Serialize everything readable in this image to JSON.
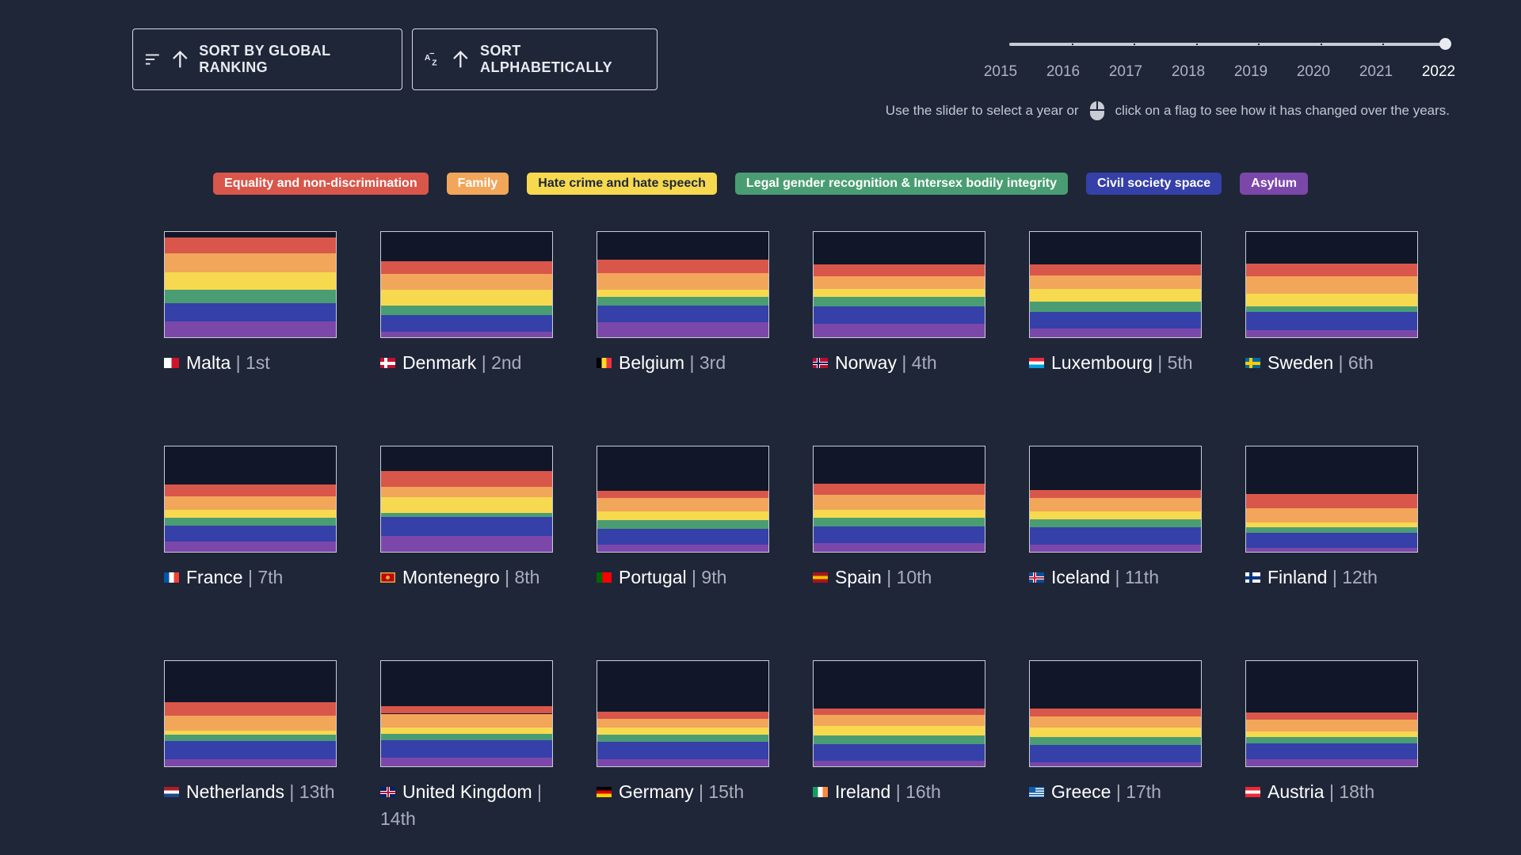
{
  "sort_buttons": {
    "global_label": "SORT BY GLOBAL RANKING",
    "alpha_label": "SORT ALPHABETICALLY"
  },
  "year_slider": {
    "years": [
      "2015",
      "2016",
      "2017",
      "2018",
      "2019",
      "2020",
      "2021",
      "2022"
    ],
    "selected": "2022"
  },
  "hint": {
    "before": "Use the slider to select a year or",
    "after": "click on a flag to see how it has changed over the years."
  },
  "legend": [
    {
      "label": "Equality and non-discrimination",
      "color": "#d9564a"
    },
    {
      "label": "Family",
      "color": "#f2a65a"
    },
    {
      "label": "Hate crime and hate speech",
      "color": "#f6d94f",
      "text_color": "#1f2638"
    },
    {
      "label": "Legal gender recognition & Intersex bodily integrity",
      "color": "#4a9d73"
    },
    {
      "label": "Civil society space",
      "color": "#3540a8"
    },
    {
      "label": "Asylum",
      "color": "#7b48aa"
    }
  ],
  "countries": [
    {
      "name": "Malta",
      "rank": "1st",
      "flag_icon": "malta-flag-icon",
      "mini": [
        "#ffffff",
        "#cf142b"
      ],
      "mini_dir": "v",
      "scores": [
        0.15,
        0.18,
        0.17,
        0.13,
        0.17,
        0.15
      ]
    },
    {
      "name": "Denmark",
      "rank": "2nd",
      "flag_icon": "denmark-flag-icon",
      "mini": [
        "#c8102e",
        "#ffffff"
      ],
      "mini_dir": "cross",
      "scores": [
        0.12,
        0.15,
        0.15,
        0.09,
        0.16,
        0.05
      ]
    },
    {
      "name": "Belgium",
      "rank": "3rd",
      "flag_icon": "belgium-flag-icon",
      "mini": [
        "#000000",
        "#fdda24",
        "#ef3340"
      ],
      "mini_dir": "v",
      "scores": [
        0.13,
        0.16,
        0.07,
        0.08,
        0.16,
        0.14
      ]
    },
    {
      "name": "Norway",
      "rank": "4th",
      "flag_icon": "norway-flag-icon",
      "mini": [
        "#ba0c2f",
        "#ffffff",
        "#00205b"
      ],
      "mini_dir": "cross",
      "scores": [
        0.11,
        0.12,
        0.08,
        0.09,
        0.16,
        0.13
      ]
    },
    {
      "name": "Luxembourg",
      "rank": "5th",
      "flag_icon": "luxembourg-flag-icon",
      "mini": [
        "#ed2939",
        "#ffffff",
        "#00a1de"
      ],
      "mini_dir": "h",
      "scores": [
        0.1,
        0.13,
        0.12,
        0.1,
        0.16,
        0.08
      ]
    },
    {
      "name": "Sweden",
      "rank": "6th",
      "flag_icon": "sweden-flag-icon",
      "mini": [
        "#006aa7",
        "#fecc00"
      ],
      "mini_dir": "cross",
      "scores": [
        0.12,
        0.17,
        0.12,
        0.05,
        0.17,
        0.07
      ]
    },
    {
      "name": "France",
      "rank": "7th",
      "flag_icon": "france-flag-icon",
      "mini": [
        "#0055a4",
        "#ffffff",
        "#ef4135"
      ],
      "mini_dir": "v",
      "scores": [
        0.11,
        0.13,
        0.08,
        0.07,
        0.15,
        0.1
      ]
    },
    {
      "name": "Montenegro",
      "rank": "8th",
      "flag_icon": "montenegro-flag-icon",
      "mini": [
        "#c40308",
        "#d3ae3b"
      ],
      "mini_dir": "center",
      "scores": [
        0.15,
        0.1,
        0.15,
        0.04,
        0.18,
        0.15
      ]
    },
    {
      "name": "Portugal",
      "rank": "9th",
      "flag_icon": "portugal-flag-icon",
      "mini": [
        "#006600",
        "#ff0000"
      ],
      "mini_dir": "v2",
      "scores": [
        0.07,
        0.13,
        0.08,
        0.08,
        0.15,
        0.07
      ]
    },
    {
      "name": "Spain",
      "rank": "10th",
      "flag_icon": "spain-flag-icon",
      "mini": [
        "#aa151b",
        "#f1bf00",
        "#aa151b"
      ],
      "mini_dir": "h",
      "scores": [
        0.11,
        0.14,
        0.08,
        0.08,
        0.16,
        0.08
      ]
    },
    {
      "name": "Iceland",
      "rank": "11th",
      "flag_icon": "iceland-flag-icon",
      "mini": [
        "#02529c",
        "#ffffff",
        "#dc1e35"
      ],
      "mini_dir": "cross",
      "scores": [
        0.08,
        0.13,
        0.07,
        0.08,
        0.16,
        0.07
      ]
    },
    {
      "name": "Finland",
      "rank": "12th",
      "flag_icon": "finland-flag-icon",
      "mini": [
        "#ffffff",
        "#003580"
      ],
      "mini_dir": "cross",
      "scores": [
        0.14,
        0.13,
        0.05,
        0.05,
        0.14,
        0.04
      ]
    },
    {
      "name": "Netherlands",
      "rank": "13th",
      "flag_icon": "netherlands-flag-icon",
      "mini": [
        "#ae1c28",
        "#ffffff",
        "#21468b"
      ],
      "mini_dir": "h",
      "scores": [
        0.13,
        0.14,
        0.04,
        0.06,
        0.17,
        0.07
      ]
    },
    {
      "name": "United Kingdom",
      "rank": "14th",
      "flag_icon": "united-kingdom-flag-icon",
      "mini": [
        "#012169",
        "#ffffff",
        "#c8102e"
      ],
      "mini_dir": "uk",
      "scores": [
        0.07,
        0.13,
        0.06,
        0.06,
        0.17,
        0.08
      ]
    },
    {
      "name": "Germany",
      "rank": "15th",
      "flag_icon": "germany-flag-icon",
      "mini": [
        "#000000",
        "#dd0000",
        "#ffce00"
      ],
      "mini_dir": "h",
      "scores": [
        0.07,
        0.08,
        0.07,
        0.07,
        0.16,
        0.07
      ]
    },
    {
      "name": "Ireland",
      "rank": "16th",
      "flag_icon": "ireland-flag-icon",
      "mini": [
        "#169b62",
        "#ffffff",
        "#ff883e"
      ],
      "mini_dir": "v",
      "scores": [
        0.06,
        0.11,
        0.09,
        0.08,
        0.16,
        0.05
      ]
    },
    {
      "name": "Greece",
      "rank": "17th",
      "flag_icon": "greece-flag-icon",
      "mini": [
        "#0d5eaf",
        "#ffffff"
      ],
      "mini_dir": "stripes",
      "scores": [
        0.08,
        0.1,
        0.09,
        0.08,
        0.16,
        0.04
      ]
    },
    {
      "name": "Austria",
      "rank": "18th",
      "flag_icon": "austria-flag-icon",
      "mini": [
        "#ed2939",
        "#ffffff",
        "#ed2939"
      ],
      "mini_dir": "h",
      "scores": [
        0.07,
        0.11,
        0.05,
        0.06,
        0.15,
        0.07
      ]
    }
  ]
}
